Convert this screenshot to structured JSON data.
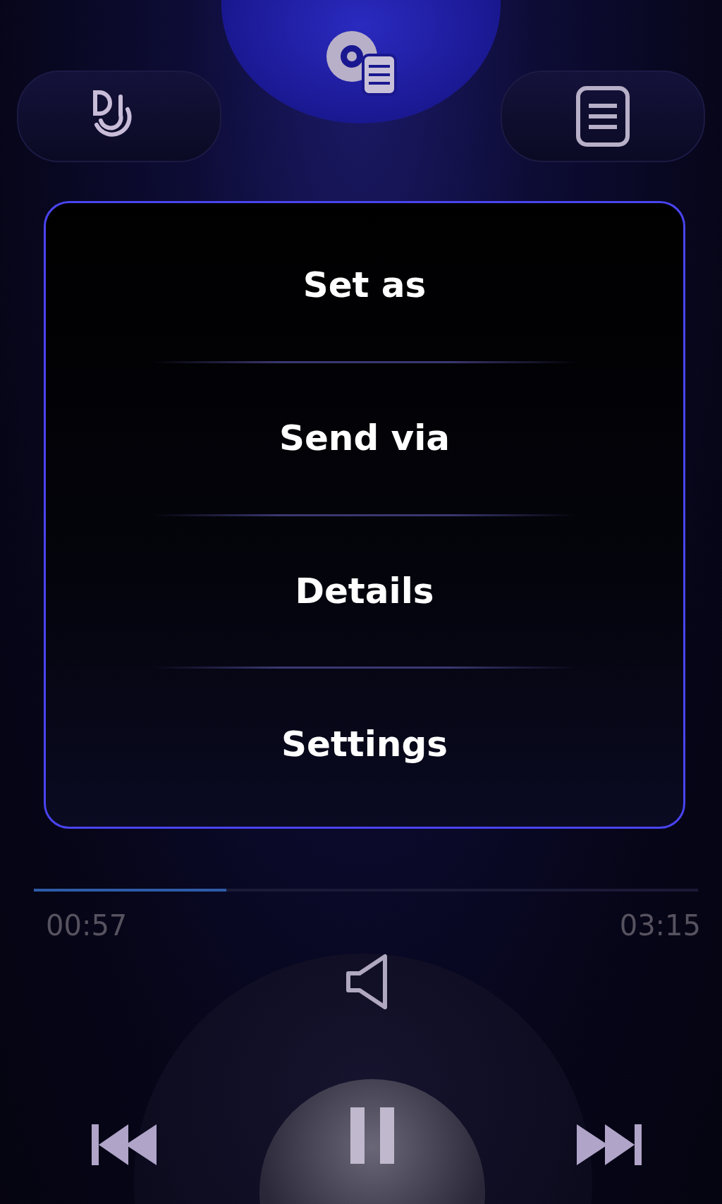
{
  "menu": {
    "items": [
      {
        "label": "Set as"
      },
      {
        "label": "Send via"
      },
      {
        "label": "Details"
      },
      {
        "label": "Settings"
      }
    ]
  },
  "progress": {
    "level": 0.29,
    "elapsed": "00:57",
    "total": "03:15"
  },
  "playback": {
    "playing": true
  }
}
